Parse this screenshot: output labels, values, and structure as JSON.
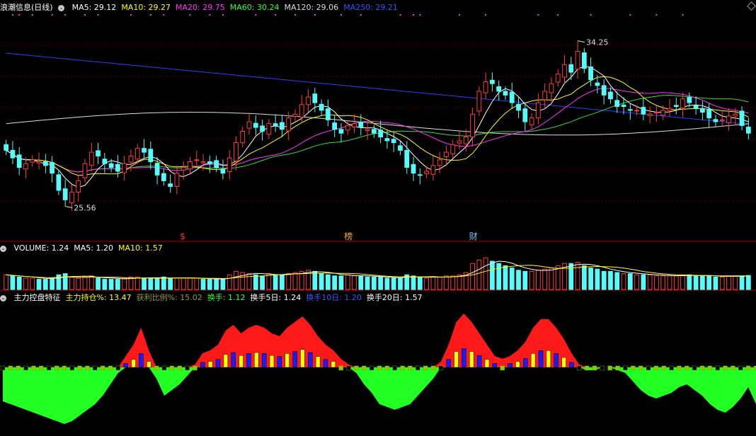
{
  "price_panel": {
    "title": "浪潮信息(日线)",
    "ma_labels": [
      {
        "text": "MA5: 29.12",
        "color": "#ffffff"
      },
      {
        "text": "MA10: 29.27",
        "color": "#ffff00"
      },
      {
        "text": "MA20: 29.75",
        "color": "#ff33ff"
      },
      {
        "text": "MA60: 30.24",
        "color": "#33ff33"
      },
      {
        "text": "MA120: 29.06",
        "color": "#dddddd"
      },
      {
        "text": "MA250: 29.21",
        "color": "#3355ff"
      }
    ],
    "high_label": "34.25",
    "low_label": "25.56",
    "markers": [
      {
        "text": "$",
        "color": "#ff3333"
      },
      {
        "text": "榜",
        "color": "#ffaa33"
      },
      {
        "text": "财",
        "color": "#66ccff"
      }
    ]
  },
  "volume_panel": {
    "labels": [
      {
        "text": "VOLUME: 1.24",
        "color": "#ffffff"
      },
      {
        "text": "MA5: 1.20",
        "color": "#ffffff"
      },
      {
        "text": "MA10: 1.57",
        "color": "#ffff00"
      }
    ]
  },
  "indicator_panel": {
    "labels": [
      {
        "text": "主力控盘特征",
        "color": "#ffffff"
      },
      {
        "text": "主力持仓%: 13.47",
        "color": "#ffff00"
      },
      {
        "text": "获利比例%: 15.02",
        "color": "#999933"
      },
      {
        "text": "换手: 1.12",
        "color": "#33ff33"
      },
      {
        "text": "换手5日: 1.24",
        "color": "#ffffff"
      },
      {
        "text": "换手10日: 1.20",
        "color": "#3355ff"
      },
      {
        "text": "换手20日: 1.57",
        "color": "#ffffff"
      }
    ]
  },
  "chart_data": [
    {
      "type": "candlestick",
      "title": "浪潮信息(日线)",
      "ylim": [
        24.5,
        35.5
      ],
      "high": 34.25,
      "low": 25.56,
      "close": [
        28.5,
        28.1,
        27.6,
        27.8,
        28.0,
        27.9,
        27.7,
        27.3,
        26.4,
        25.9,
        26.3,
        26.9,
        27.8,
        28.4,
        28.2,
        27.8,
        27.6,
        27.4,
        27.8,
        28.2,
        28.6,
        28.4,
        27.9,
        27.2,
        26.9,
        26.6,
        27.3,
        27.6,
        27.9,
        28.0,
        27.9,
        27.8,
        27.6,
        27.3,
        28.1,
        28.9,
        29.5,
        30.0,
        29.7,
        29.5,
        29.9,
        29.8,
        29.6,
        30.2,
        30.4,
        30.9,
        31.3,
        31.0,
        30.6,
        30.1,
        29.6,
        29.4,
        29.8,
        29.9,
        29.7,
        29.6,
        29.4,
        29.2,
        29.0,
        28.9,
        28.5,
        27.6,
        27.3,
        27.2,
        27.4,
        27.7,
        28.0,
        28.4,
        28.8,
        29.0,
        29.2,
        30.4,
        31.6,
        32.1,
        32.0,
        31.6,
        31.4,
        31.0,
        30.6,
        30.0,
        30.2,
        31.0,
        31.6,
        32.0,
        32.5,
        33.0,
        32.6,
        33.7,
        32.8,
        32.2,
        31.9,
        31.4,
        31.2,
        30.8,
        30.8,
        30.6,
        30.6,
        30.4,
        30.4,
        30.5,
        30.6,
        30.7,
        30.8,
        31.2,
        31.0,
        30.7,
        30.5,
        30.2,
        30.0,
        30.1,
        30.3,
        30.4,
        29.8,
        29.4
      ]
    },
    {
      "type": "bar",
      "title": "VOLUME",
      "values": [
        1.3,
        1.2,
        1.1,
        1.0,
        1.0,
        0.9,
        0.9,
        1.0,
        1.3,
        1.4,
        1.1,
        1.0,
        1.1,
        1.2,
        1.0,
        0.9,
        0.9,
        0.9,
        1.0,
        1.1,
        1.1,
        1.0,
        1.0,
        1.0,
        1.1,
        1.0,
        1.0,
        1.0,
        1.0,
        1.0,
        0.9,
        0.9,
        0.9,
        0.9,
        1.3,
        1.6,
        1.5,
        1.4,
        1.3,
        1.2,
        1.4,
        1.3,
        1.3,
        1.4,
        1.5,
        1.6,
        1.7,
        1.6,
        1.4,
        1.3,
        1.2,
        1.2,
        1.3,
        1.2,
        1.2,
        1.1,
        1.1,
        1.1,
        1.0,
        1.0,
        1.0,
        1.3,
        1.2,
        1.1,
        1.0,
        1.1,
        1.1,
        1.2,
        1.2,
        1.3,
        1.5,
        2.3,
        2.6,
        2.8,
        2.5,
        2.3,
        2.1,
        1.9,
        1.7,
        1.6,
        1.6,
        1.7,
        1.8,
        1.9,
        2.1,
        2.3,
        2.3,
        2.4,
        2.1,
        1.9,
        1.8,
        1.6,
        1.6,
        1.5,
        1.4,
        1.4,
        1.3,
        1.3,
        1.3,
        1.2,
        1.2,
        1.2,
        1.2,
        1.3,
        1.3,
        1.2,
        1.2,
        1.2,
        1.1,
        1.1,
        1.2,
        1.2,
        1.2,
        1.24
      ]
    },
    {
      "type": "area",
      "title": "主力控盘特征",
      "values": [
        -1.2,
        -1.3,
        -1.4,
        -1.5,
        -1.6,
        -1.7,
        -1.8,
        -1.9,
        -2.0,
        -1.9,
        -1.7,
        -1.5,
        -1.3,
        -1.0,
        -0.6,
        -0.2,
        0.4,
        0.8,
        1.4,
        0.6,
        -0.4,
        -1.0,
        -0.8,
        -0.6,
        -0.3,
        0.1,
        0.5,
        0.6,
        0.8,
        1.3,
        1.5,
        1.2,
        1.4,
        1.5,
        1.4,
        1.2,
        1.1,
        1.4,
        1.6,
        1.8,
        1.5,
        1.1,
        0.8,
        0.6,
        0.3,
        0.1,
        -0.2,
        -0.6,
        -0.9,
        -1.3,
        -1.4,
        -1.5,
        -1.4,
        -1.3,
        -1.0,
        -0.7,
        -0.4,
        0.2,
        0.8,
        1.6,
        1.9,
        1.6,
        1.2,
        0.8,
        0.4,
        0.3,
        0.4,
        0.6,
        0.9,
        1.4,
        1.7,
        1.7,
        1.4,
        1.0,
        0.5,
        0.1,
        -0.1,
        -0.1,
        0.0,
        0.0,
        -0.1,
        -0.2,
        -0.5,
        -0.8,
        -1.0,
        -1.1,
        -1.0,
        -0.9,
        -0.7,
        -0.6,
        -0.8,
        -1.0,
        -1.3,
        -1.5,
        -1.6,
        -1.4,
        -1.1,
        -0.7,
        -1.3
      ]
    }
  ]
}
